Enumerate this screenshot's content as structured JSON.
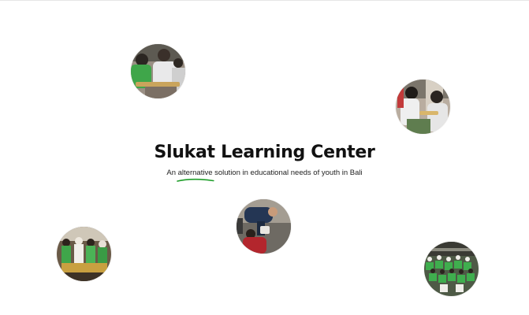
{
  "hero": {
    "title": "Slukat Learning Center",
    "subtitle": {
      "before": "An ",
      "highlight": "alternative",
      "after": " solution in educational needs of youth in Bali"
    },
    "highlight_color": "#1f9e2a"
  },
  "photos": [
    {
      "id": "photo-students-green-shirts",
      "subject": "students in green and white shirts holding a bamboo instrument"
    },
    {
      "id": "photo-students-bamboo-craft",
      "subject": "students working with bamboo"
    },
    {
      "id": "photo-volunteer-helping",
      "subject": "volunteer helping a child outdoors"
    },
    {
      "id": "photo-traditional-dress-group",
      "subject": "group of youth in traditional dress"
    },
    {
      "id": "photo-crowd-green-shirts",
      "subject": "large group of youth in green shirts"
    }
  ]
}
